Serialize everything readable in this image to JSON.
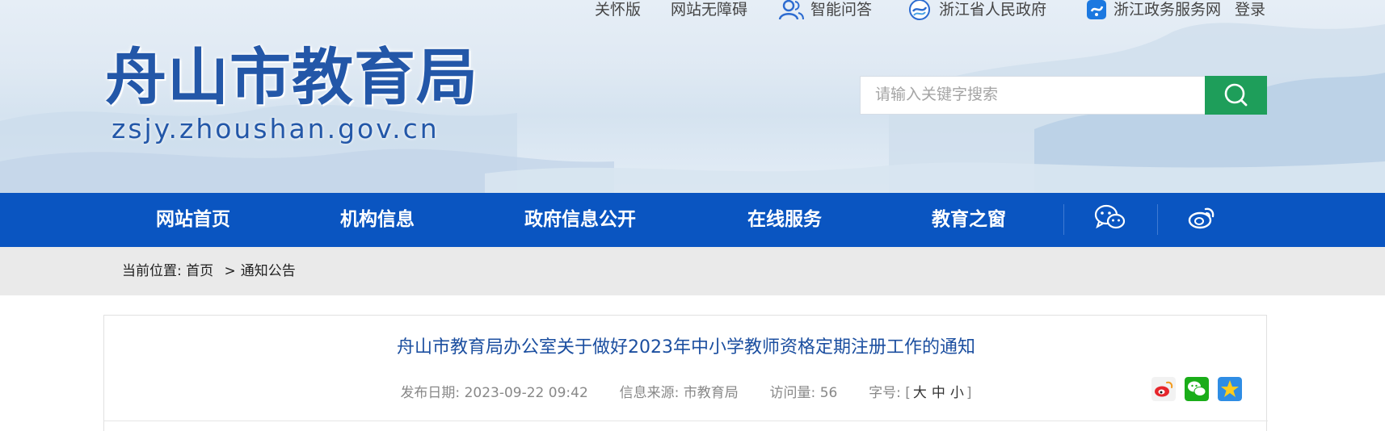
{
  "topbar": {
    "care_version": "关怀版",
    "accessibility": "网站无障碍",
    "qa": "智能问答",
    "zj_gov": "浙江省人民政府",
    "zj_service": "浙江政务服务网",
    "login": "登录"
  },
  "logo": {
    "title": "舟山市教育局",
    "url": "zsjy.zhoushan.gov.cn"
  },
  "search": {
    "placeholder": "请输入关键字搜索"
  },
  "nav": {
    "items": [
      "网站首页",
      "机构信息",
      "政府信息公开",
      "在线服务",
      "教育之窗"
    ]
  },
  "breadcrumb": {
    "prefix": "当前位置:",
    "home": "首页",
    "sep": ">",
    "current": "通知公告"
  },
  "article": {
    "title": "舟山市教育局办公室关于做好2023年中小学教师资格定期注册工作的通知",
    "date_label": "发布日期:",
    "date": "2023-09-22 09:42",
    "source_label": "信息来源:",
    "source": "市教育局",
    "views_label": "访问量:",
    "views": "56",
    "fontsize_label": "字号:",
    "bracket_open": "[",
    "fs_large": "大",
    "fs_medium": "中",
    "fs_small": "小",
    "bracket_close": "]"
  },
  "colors": {
    "nav_bg": "#0a55c1",
    "search_button": "#1e9e5a",
    "logo_blue": "#2357a8",
    "title_blue": "#1c4fa0"
  },
  "icons": [
    "user-icon",
    "zhejiang-gov-icon",
    "zhejiang-service-icon",
    "search-icon",
    "wechat-icon",
    "weibo-icon",
    "share-weibo-icon",
    "share-wechat-icon",
    "share-qzone-icon"
  ]
}
